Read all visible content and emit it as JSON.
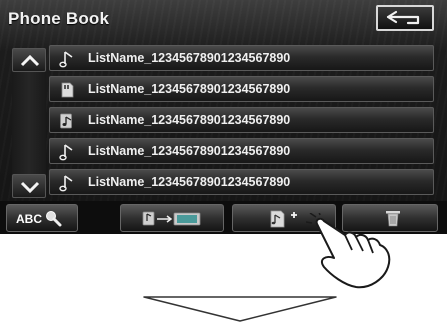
{
  "header": {
    "title": "Phone Book"
  },
  "list": {
    "items": [
      {
        "label": "ListName_12345678901234567890",
        "icon": "music-note-icon"
      },
      {
        "label": "ListName_12345678901234567890",
        "icon": "sd-card-icon"
      },
      {
        "label": "ListName_12345678901234567890",
        "icon": "device-music-icon"
      },
      {
        "label": "ListName_12345678901234567890",
        "icon": "music-note-icon"
      },
      {
        "label": "ListName_12345678901234567890",
        "icon": "music-note-icon"
      }
    ]
  },
  "toolbar": {
    "abc_label": "ABC",
    "buttons": [
      "abc-search-icon",
      "copy-to-device-icon",
      "add-entry-icon",
      "trash-icon"
    ]
  },
  "colors": {
    "screen": "#141414",
    "text": "#f0f0f0",
    "border": "#d8d8d8"
  }
}
